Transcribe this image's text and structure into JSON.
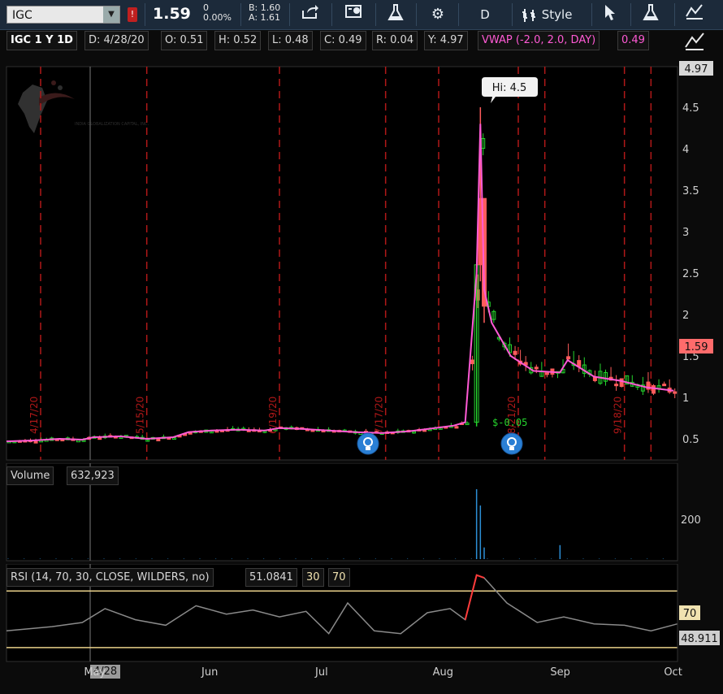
{
  "toolbar": {
    "symbol": "IGC",
    "alert": "!",
    "last_price": "1.59",
    "change": "0",
    "change_pct": "0.00%",
    "bid": "B: 1.60",
    "ask": "A: 1.61",
    "period": "D",
    "style_label": "Style",
    "icons": [
      "share-icon",
      "gadget-icon",
      "flask-icon",
      "gear-icon",
      "period-icon",
      "style-icon",
      "cursor-icon",
      "studies-flask-icon",
      "drawing-icon"
    ]
  },
  "infobar": {
    "title": "IGC 1 Y 1D",
    "date": "D: 4/28/20",
    "open": "O: 0.51",
    "high": "H: 0.52",
    "low": "L: 0.48",
    "close": "C: 0.49",
    "range": "R: 0.04",
    "year_high": "Y: 4.97",
    "vwap_label": "VWAP (-2.0, 2.0, DAY)",
    "vwap_value": "0.49"
  },
  "price_panel": {
    "y_ticks": [
      "0.5",
      "1",
      "1.5",
      "2",
      "2.5",
      "3",
      "3.5",
      "4",
      "4.5"
    ],
    "badge_high": "4.97",
    "badge_last": "1.59",
    "hi_callout": "Hi: 4.5",
    "dividend_label": "$-0.05",
    "event_dates": [
      "4/17/20",
      "5/15/20",
      "6/19/20",
      "7/17/20",
      "8/21/20",
      "9/18/20"
    ],
    "watermark": "INDIA GLOBALIZATION CAPITAL, INC."
  },
  "volume_panel": {
    "label": "Volume",
    "value": "632,923",
    "y_ticks": [
      "200"
    ]
  },
  "rsi_panel": {
    "label": "RSI (14, 70, 30, CLOSE, WILDERS, no)",
    "value": "51.0841",
    "low_level": "30",
    "high_level": "70",
    "badge_70": "70",
    "badge_value": "48.911"
  },
  "x_axis": {
    "cursor_date": "4/28",
    "months": [
      "May",
      "Jun",
      "Jul",
      "Aug",
      "Sep",
      "Oct"
    ]
  },
  "colors": {
    "up": "#25d42d",
    "down": "#ff5c5c",
    "vwap": "#ff5ad5",
    "event_line": "#b01818",
    "volume": "#2c8fd6",
    "rsi": "#8a8a8a",
    "rsi_overbought": "#ff3b3b"
  },
  "chart_data": [
    {
      "type": "line",
      "subtype": "candlestick",
      "title": "IGC 1 Y 1D",
      "x_range": [
        "2020-04-08",
        "2020-10-02"
      ],
      "ylim": [
        0.3,
        4.97
      ],
      "grid": false,
      "series": [
        {
          "name": "VWAP (-2.0, 2.0, DAY)",
          "points": [
            [
              "2020-04-08",
              0.47
            ],
            [
              "2020-04-15",
              0.48
            ],
            [
              "2020-04-22",
              0.5
            ],
            [
              "2020-04-28",
              0.49
            ],
            [
              "2020-05-01",
              0.52
            ],
            [
              "2020-05-08",
              0.53
            ],
            [
              "2020-05-15",
              0.5
            ],
            [
              "2020-05-22",
              0.52
            ],
            [
              "2020-05-26",
              0.58
            ],
            [
              "2020-06-01",
              0.6
            ],
            [
              "2020-06-08",
              0.61
            ],
            [
              "2020-06-15",
              0.6
            ],
            [
              "2020-06-19",
              0.63
            ],
            [
              "2020-06-25",
              0.62
            ],
            [
              "2020-07-02",
              0.6
            ],
            [
              "2020-07-09",
              0.58
            ],
            [
              "2020-07-16",
              0.57
            ],
            [
              "2020-07-23",
              0.59
            ],
            [
              "2020-07-30",
              0.63
            ],
            [
              "2020-08-04",
              0.66
            ],
            [
              "2020-08-07",
              0.7
            ],
            [
              "2020-08-10",
              2.5
            ],
            [
              "2020-08-11",
              4.3
            ],
            [
              "2020-08-12",
              2.3
            ],
            [
              "2020-08-14",
              1.9
            ],
            [
              "2020-08-19",
              1.5
            ],
            [
              "2020-08-25",
              1.32
            ],
            [
              "2020-09-01",
              1.3
            ],
            [
              "2020-09-03",
              1.45
            ],
            [
              "2020-09-10",
              1.25
            ],
            [
              "2020-09-17",
              1.2
            ],
            [
              "2020-09-24",
              1.12
            ],
            [
              "2020-10-01",
              1.08
            ]
          ]
        }
      ],
      "annotations": [
        "Hi: 4.5",
        "$-0.05"
      ]
    },
    {
      "type": "bar",
      "title": "Volume",
      "value_shown": "632,923",
      "y_ticks": [
        200
      ],
      "spikes": [
        [
          "2020-08-10",
          300
        ],
        [
          "2020-08-11",
          230
        ],
        [
          "2020-08-12",
          50
        ],
        [
          "2020-09-01",
          60
        ]
      ]
    },
    {
      "type": "line",
      "title": "RSI (14, 70, 30, CLOSE, WILDERS, no)",
      "levels": [
        30,
        70
      ],
      "ylim": [
        20,
        90
      ],
      "current": 51.0841,
      "points": [
        [
          "2020-04-08",
          42
        ],
        [
          "2020-04-20",
          45
        ],
        [
          "2020-04-28",
          48
        ],
        [
          "2020-05-04",
          58
        ],
        [
          "2020-05-12",
          50
        ],
        [
          "2020-05-20",
          46
        ],
        [
          "2020-05-28",
          60
        ],
        [
          "2020-06-05",
          54
        ],
        [
          "2020-06-12",
          57
        ],
        [
          "2020-06-19",
          52
        ],
        [
          "2020-06-26",
          56
        ],
        [
          "2020-07-02",
          40
        ],
        [
          "2020-07-07",
          62
        ],
        [
          "2020-07-14",
          42
        ],
        [
          "2020-07-21",
          40
        ],
        [
          "2020-07-28",
          55
        ],
        [
          "2020-08-03",
          58
        ],
        [
          "2020-08-07",
          50
        ],
        [
          "2020-08-10",
          82
        ],
        [
          "2020-08-12",
          80
        ],
        [
          "2020-08-18",
          62
        ],
        [
          "2020-08-26",
          48
        ],
        [
          "2020-09-02",
          52
        ],
        [
          "2020-09-10",
          47
        ],
        [
          "2020-09-18",
          46
        ],
        [
          "2020-09-25",
          42
        ],
        [
          "2020-10-02",
          47
        ]
      ]
    }
  ]
}
